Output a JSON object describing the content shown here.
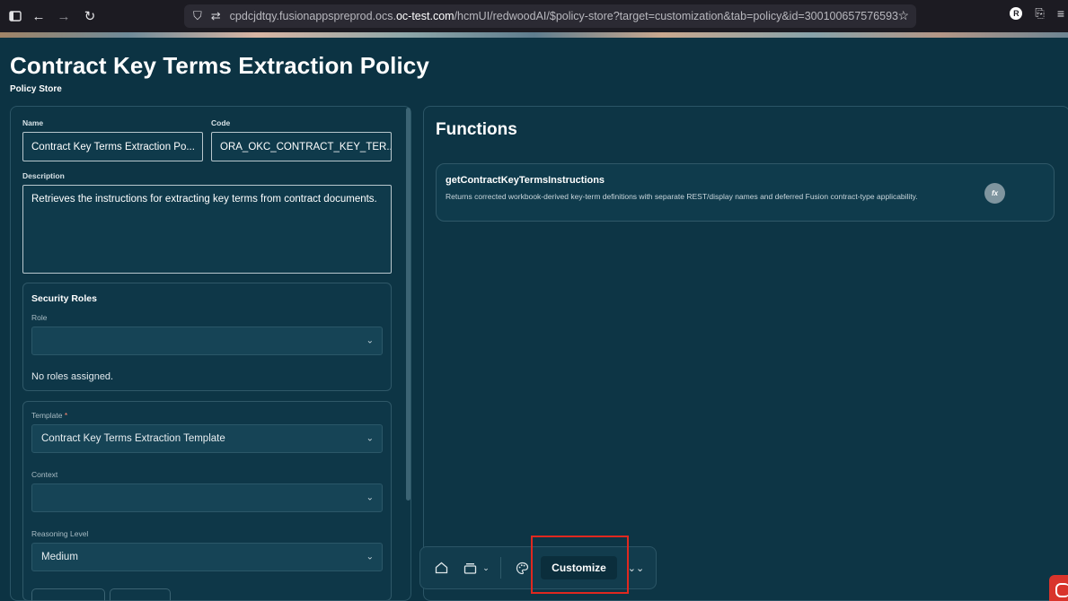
{
  "browser": {
    "url_prefix": "cpdcjdtqy.fusionappspreprod.ocs.",
    "url_host": "oc-test.com",
    "url_path": "/hcmUI/redwoodAI/$policy-store?target=customization&tab=policy&id=300100657576593",
    "profile_initial": "R"
  },
  "page": {
    "title": "Contract Key Terms Extraction Policy",
    "subtitle": "Policy Store"
  },
  "form": {
    "name_label": "Name",
    "name_value": "Contract Key Terms Extraction Po...",
    "code_label": "Code",
    "code_value": "ORA_OKC_CONTRACT_KEY_TER...",
    "description_label": "Description",
    "description_value": "Retrieves the instructions for extracting key terms from contract documents.",
    "security": {
      "title": "Security Roles",
      "role_label": "Role",
      "role_value": "",
      "empty_text": "No roles assigned."
    },
    "template_label": "Template",
    "template_required": "*",
    "template_value": "Contract Key Terms Extraction Template",
    "context_label": "Context",
    "context_value": "",
    "reasoning_label": "Reasoning Level",
    "reasoning_value": "Medium"
  },
  "functions": {
    "title": "Functions",
    "items": [
      {
        "name": "getContractKeyTermsInstructions",
        "description": "Returns corrected workbook-derived key-term definitions with separate REST/display names and deferred Fusion contract-type applicability.",
        "badge": "fx"
      }
    ]
  },
  "toolbar": {
    "customize_label": "Customize"
  },
  "colors": {
    "background": "#0c3343",
    "highlight": "#e0281f",
    "oracle_red": "#d9342b"
  }
}
